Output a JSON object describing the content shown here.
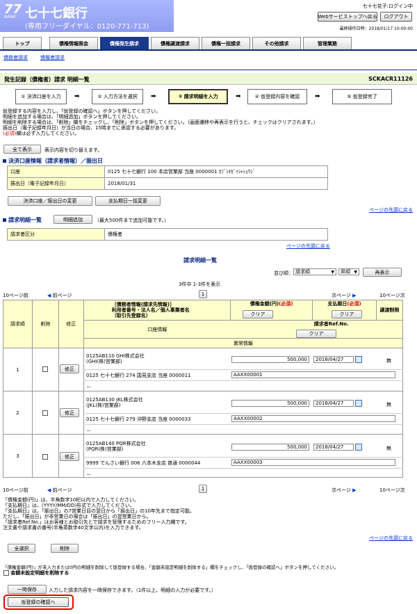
{
  "header": {
    "logo_num": "77",
    "logo_sub": "BANK",
    "bank_name": "七十七銀行",
    "phone": "(専用フリーダイヤル：0120-771-713)",
    "user": "七十七花子:ログイン中",
    "websvc_button": "Webサービストップへ戻る",
    "logout_button": "ログアウト",
    "last_op": "最終操作日時：2018/01/17 10:00:00"
  },
  "tabs": [
    "トップ",
    "債権情報照会",
    "債権発生請求",
    "債権譲渡請求",
    "債権一括請求",
    "その他請求",
    "管理業務"
  ],
  "subnav": [
    "債務者請求",
    "債権者請求"
  ],
  "page": {
    "title": "発生記録（債権者）請求 明細一覧",
    "screen_id": "SCKACR11126"
  },
  "steps": [
    "① 決済口座を入力",
    "② 入力方法を選択",
    "③ 請求明細を入力",
    "④ 仮登録内容を確認",
    "⑤ 仮登録完了"
  ],
  "intro": [
    "仮登録する内容を入力し、「仮登録の確認へ」ボタンを押してください。",
    "明細を追加する場合は、「明細追加」ボタンを押してください。",
    "明細を削除する場合は、「削除」欄をチェックし、「削除」ボタンを押してください。（画面遷移や再表示を行うと、チェックはクリアされます。）",
    "振出日（電子記録年月日）が当日の場合、15時までに承認する必要があります。",
    "(必須)",
    "欄は必ず入力してください。"
  ],
  "show_all": {
    "button": "全て表示",
    "desc": "表示内容を切り替えます。"
  },
  "account_section": {
    "title": "決済口座情報（請求者情報）／振出日",
    "rows": [
      {
        "label": "口座",
        "value": "0125 七十七銀行 100 本店営業部 当座 0000001 ｶﾌﾞｼｷｶﾞｲｼｬｼｮｳｼﾞ"
      },
      {
        "label": "振出日（電子記録年月日）",
        "value": "2018/01/31"
      }
    ],
    "btn_change": "決済口座／振出日の変更",
    "btn_bulk": "支払期日一括変更"
  },
  "page_top": "ページの先頭に戻る",
  "detail_section": {
    "title": "請求明細一覧",
    "add_button": "明細追加",
    "add_note": "（最大500件まで追加可能です。）",
    "role_label": "請求者区分",
    "role_value": "債権者"
  },
  "list": {
    "caption": "請求明細一覧",
    "sort_label": "並び順：",
    "sort_value": "請求順",
    "order_value": "昇順",
    "redisplay": "再表示",
    "count": "3件中 1-3件を表示",
    "prev10": "10ページ前",
    "prev": "前ページ",
    "next": "次ページ",
    "next10": "10ページ次",
    "page_no": "1"
  },
  "table_head": {
    "seq": "請求順",
    "del": "削除",
    "edit": "修正",
    "debtor": "［債務者情報(請求先情報)］",
    "debtor2": "利用者番号・法人名／個人事業者名",
    "debtor3": "（取引先登録名）",
    "amount": "債権金額(円)",
    "required": "(必須)",
    "clear": "クリア",
    "due": "支払期日",
    "limit": "譲渡制限",
    "account": "口座情報",
    "ref": "請求者Ref.No.",
    "abnormal": "異常情報"
  },
  "rows": [
    {
      "seq": "1",
      "edit": "修正",
      "code": "0125AB110",
      "name": "GHI株式会社",
      "kana": "(GHI(株)営業部)",
      "account": "0125 七十七銀行 274 国見支店 当座 0000011",
      "amount": "500,000",
      "date": "2018/04/27",
      "limit": "無",
      "ref": "AAXX00001",
      "abn": "－"
    },
    {
      "seq": "2",
      "edit": "修正",
      "code": "0125AB130",
      "name": "JKL株式会社",
      "kana": "(JKL(株)営業部)",
      "account": "0125 七十七銀行 279 沖野支店 当座 0000033",
      "amount": "500,000",
      "date": "2018/04/27",
      "limit": "無",
      "ref": "AAXX00002",
      "abn": "－"
    },
    {
      "seq": "3",
      "edit": "修正",
      "code": "0125AB140",
      "name": "PQR株式会社",
      "kana": "(PQR(株)営業部)",
      "account": "9999 でんさい銀行 006 六本木支店 普通 0000044",
      "amount": "500,000",
      "date": "2018/04/27",
      "limit": "無",
      "ref": "AAXX00003",
      "abn": "－"
    }
  ],
  "notes": [
    "「債権金額(円)」は、半角数字10桁以内で入力してください。",
    "「支払期日」は、(YYYY/MM/DD)形式で入力してください。",
    "「支払期日」は、「振出日」の7営業日目の翌日から「振出日」の10年先まで指定可能。",
    "ただし、「振出日」が非営業日の場合は「振出日」の翌営業日から。",
    "「請求者Ref.No.」はお客様とお取引先とで請求を管理するためのフリー入力欄です。",
    "注文書や請求書の番号(半角英数字40文字以内)を入力できます。"
  ],
  "bottom": {
    "select_all": "全選択",
    "delete": "削除",
    "note": "「債権金額(円)」が未入力または0円の明細を削除して仮登録する場合、「金額未設定明細を削除する」欄をチェックし、「仮登録の確認へ」ボタンを押してください。",
    "checkbox_label": "金額未設定明細を削除する",
    "temp_save": "一時保存",
    "temp_note": "入力した請求内容を一時保存できます。（1件以上、明細の入力が必要です。）",
    "confirm": "仮登録の確認へ"
  },
  "colors": {
    "navy": "#0a2a80",
    "highlight": "#ffffcc",
    "required": "#cc0000"
  }
}
